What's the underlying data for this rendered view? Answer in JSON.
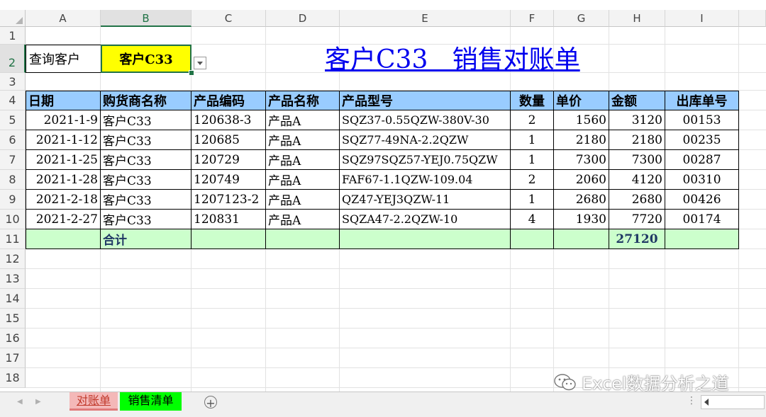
{
  "columns": [
    "A",
    "B",
    "C",
    "D",
    "E",
    "F",
    "G",
    "H",
    "I"
  ],
  "rows": [
    "1",
    "2",
    "3",
    "4",
    "5",
    "6",
    "7",
    "8",
    "9",
    "10",
    "11",
    "12",
    "13",
    "14",
    "15",
    "16",
    "17",
    "18"
  ],
  "query": {
    "label": "查询客户",
    "value": "客户C33"
  },
  "title": "客户C33   销售对账单",
  "table": {
    "headers": [
      "日期",
      "购货商名称",
      "产品编码",
      "产品名称",
      "产品型号",
      "数量",
      "单价",
      "金额",
      "出库单号"
    ],
    "rows": [
      [
        "2021-1-9",
        "客户C33",
        "120638-3",
        "产品A",
        "SQZ37-0.55QZW-380V-30",
        "2",
        "1560",
        "3120",
        "00153"
      ],
      [
        "2021-1-12",
        "客户C33",
        "120685",
        "产品A",
        "SQZ77-49NA-2.2QZW",
        "1",
        "2180",
        "2180",
        "00235"
      ],
      [
        "2021-1-25",
        "客户C33",
        "120729",
        "产品A",
        "SQZ97SQZ57-YEJ0.75QZW",
        "1",
        "7300",
        "7300",
        "00287"
      ],
      [
        "2021-1-28",
        "客户C33",
        "120749",
        "产品A",
        "FAF67-1.1QZW-109.04",
        "2",
        "2060",
        "4120",
        "00310"
      ],
      [
        "2021-2-18",
        "客户C33",
        "1207123-2",
        "产品A",
        "QZ47-YEJ3QZW-11",
        "1",
        "2680",
        "2680",
        "00426"
      ],
      [
        "2021-2-27",
        "客户C33",
        "120831",
        "产品A",
        "SQZA47-2.2QZW-10",
        "4",
        "1930",
        "7720",
        "00174"
      ]
    ],
    "total_label": "合计",
    "total_value": "27120"
  },
  "tabs": [
    {
      "label": "对账单",
      "color": "#f4b8b8"
    },
    {
      "label": "销售清单",
      "color": "#00ff00"
    }
  ],
  "watermark": "Excel数据分析之道",
  "colors": {
    "query_value_bg": "#ffff00",
    "header_bg": "#99ccff",
    "total_bg": "#ccffcc",
    "title": "#0000ee"
  }
}
